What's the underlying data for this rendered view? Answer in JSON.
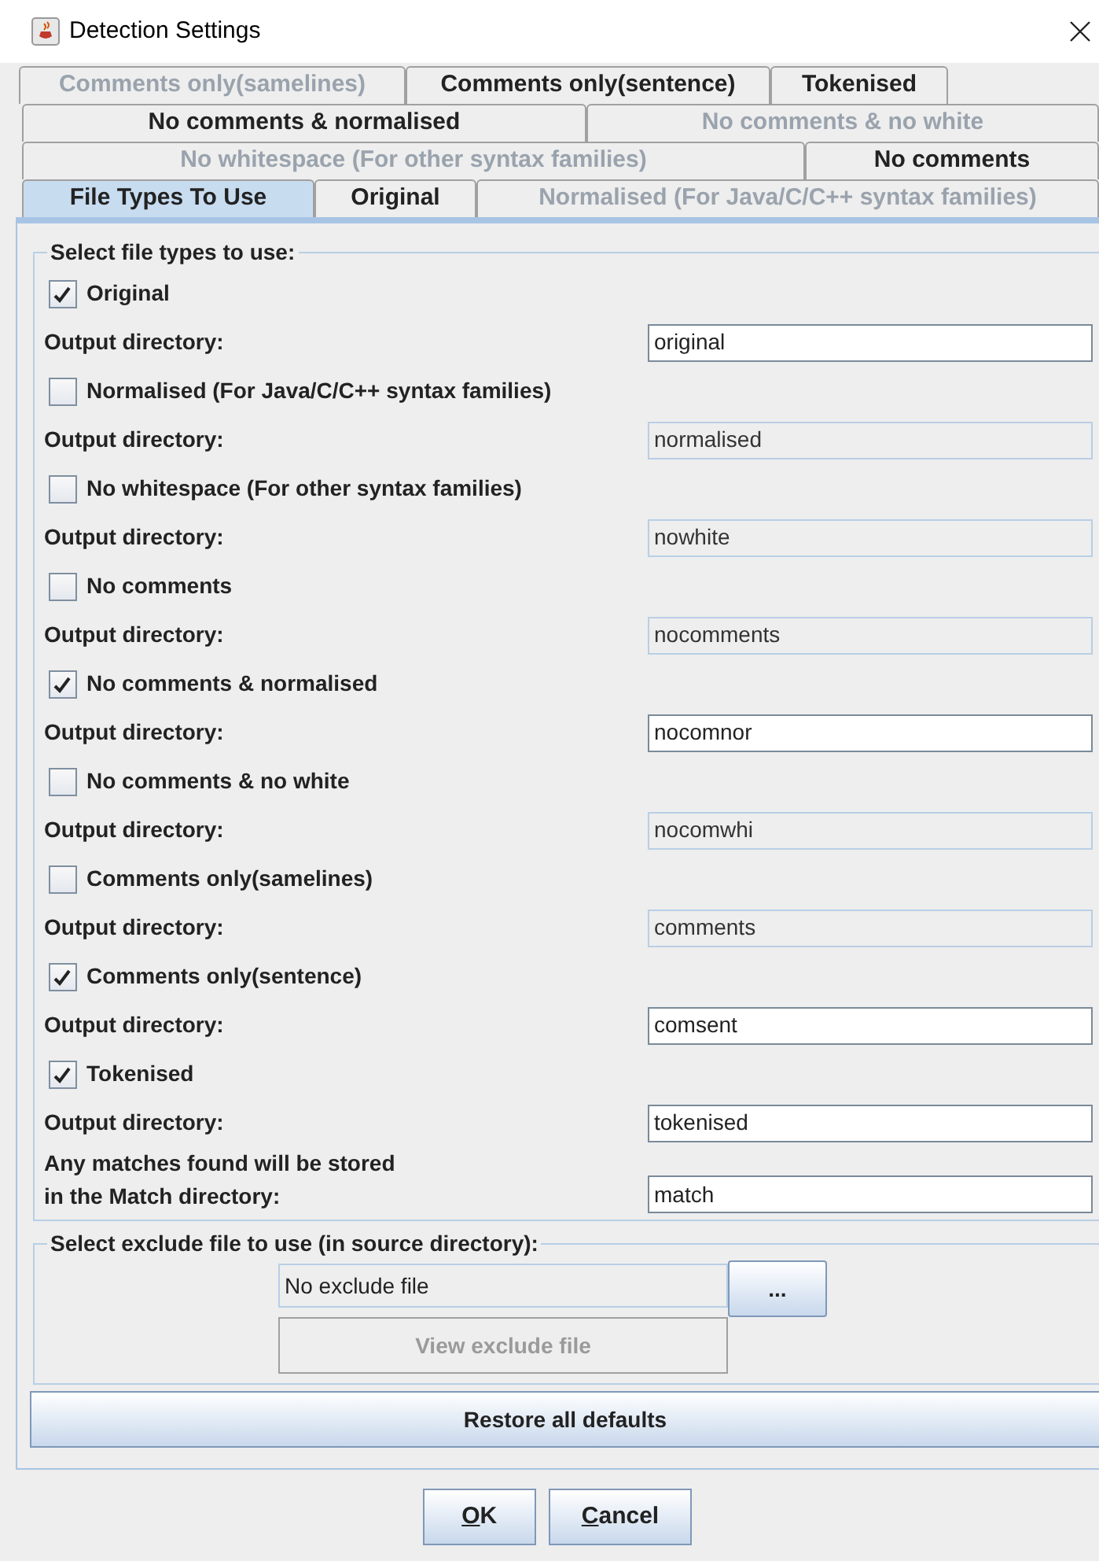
{
  "window": {
    "title": "Detection Settings"
  },
  "tab_rows": [
    [
      {
        "label": "Comments only(samelines)",
        "disabled": true,
        "selected": false
      },
      {
        "label": "Comments only(sentence)",
        "disabled": false,
        "selected": false
      },
      {
        "label": "Tokenised",
        "disabled": false,
        "selected": false
      }
    ],
    [
      {
        "label": "No comments & normalised",
        "disabled": false,
        "selected": false
      },
      {
        "label": "No comments & no white",
        "disabled": true,
        "selected": false
      }
    ],
    [
      {
        "label": "No whitespace (For other syntax families)",
        "disabled": true,
        "selected": false
      },
      {
        "label": "No comments",
        "disabled": false,
        "selected": false
      }
    ],
    [
      {
        "label": "File Types To Use",
        "disabled": false,
        "selected": true
      },
      {
        "label": "Original",
        "disabled": false,
        "selected": false
      },
      {
        "label": "Normalised (For Java/C/C++ syntax families)",
        "disabled": true,
        "selected": false
      }
    ]
  ],
  "file_types": {
    "title": "Select file types to use:",
    "items": [
      {
        "label": "Original",
        "checked": true,
        "output_label": "Output directory:",
        "directory": "original"
      },
      {
        "label": "Normalised (For Java/C/C++ syntax families)",
        "checked": false,
        "output_label": "Output directory:",
        "directory": "normalised"
      },
      {
        "label": "No whitespace (For other syntax families)",
        "checked": false,
        "output_label": "Output directory:",
        "directory": "nowhite"
      },
      {
        "label": "No comments",
        "checked": false,
        "output_label": "Output directory:",
        "directory": "nocomments"
      },
      {
        "label": "No comments & normalised",
        "checked": true,
        "output_label": "Output directory:",
        "directory": "nocomnor"
      },
      {
        "label": "No comments & no white",
        "checked": false,
        "output_label": "Output directory:",
        "directory": "nocomwhi"
      },
      {
        "label": "Comments only(samelines)",
        "checked": false,
        "output_label": "Output directory:",
        "directory": "comments"
      },
      {
        "label": "Comments only(sentence)",
        "checked": true,
        "output_label": "Output directory:",
        "directory": "comsent"
      },
      {
        "label": "Tokenised",
        "checked": true,
        "output_label": "Output directory:",
        "directory": "tokenised"
      }
    ],
    "match_label_lines": [
      "Any matches found will be stored",
      "in the Match directory:"
    ],
    "match_directory": "match"
  },
  "exclude": {
    "title": "Select exclude file to use (in source directory):",
    "file": "No exclude file",
    "browse_button": "...",
    "view_button": {
      "label": "View exclude file",
      "disabled": true
    }
  },
  "restore_button": "Restore all defaults",
  "buttons": [
    {
      "label": "OK",
      "underline_first": true
    },
    {
      "label": "Cancel",
      "underline_first": true
    }
  ]
}
